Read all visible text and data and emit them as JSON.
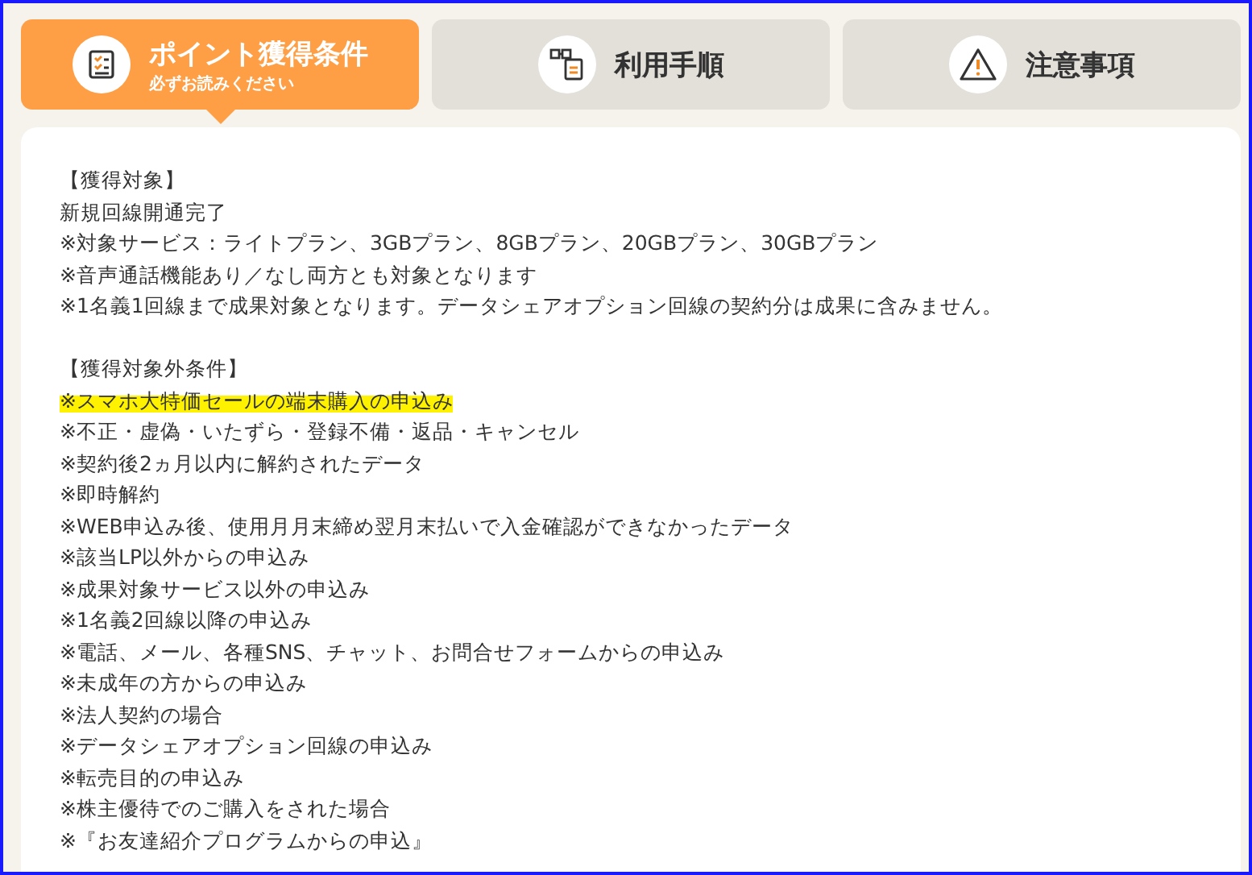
{
  "tabs": [
    {
      "label": "ポイント獲得条件",
      "sublabel": "必ずお読みください",
      "kind": "checklist",
      "selected": true
    },
    {
      "label": "利用手順",
      "kind": "steps",
      "selected": false
    },
    {
      "label": "注意事項",
      "kind": "warning",
      "selected": false
    }
  ],
  "sections": [
    {
      "heading": "【獲得対象】",
      "lines": [
        {
          "text": "新規回線開通完了",
          "highlighted": false
        },
        {
          "text": "※対象サービス：ライトプラン、3GBプラン、8GBプラン、20GBプラン、30GBプラン",
          "highlighted": false
        },
        {
          "text": "※音声通話機能あり／なし両方とも対象となります",
          "highlighted": false
        },
        {
          "text": "※1名義1回線まで成果対象となります。データシェアオプション回線の契約分は成果に含みません。",
          "highlighted": false
        }
      ]
    },
    {
      "heading": "【獲得対象外条件】",
      "lines": [
        {
          "text": "※スマホ大特価セールの端末購入の申込み",
          "highlighted": true
        },
        {
          "text": "※不正・虚偽・いたずら・登録不備・返品・キャンセル",
          "highlighted": false
        },
        {
          "text": "※契約後2ヵ月以内に解約されたデータ",
          "highlighted": false
        },
        {
          "text": "※即時解約",
          "highlighted": false
        },
        {
          "text": "※WEB申込み後、使用月月末締め翌月末払いで入金確認ができなかったデータ",
          "highlighted": false
        },
        {
          "text": "※該当LP以外からの申込み",
          "highlighted": false
        },
        {
          "text": "※成果対象サービス以外の申込み",
          "highlighted": false
        },
        {
          "text": "※1名義2回線以降の申込み",
          "highlighted": false
        },
        {
          "text": "※電話、メール、各種SNS、チャット、お問合せフォームからの申込み",
          "highlighted": false
        },
        {
          "text": "※未成年の方からの申込み",
          "highlighted": false
        },
        {
          "text": "※法人契約の場合",
          "highlighted": false
        },
        {
          "text": "※データシェアオプション回線の申込み",
          "highlighted": false
        },
        {
          "text": "※転売目的の申込み",
          "highlighted": false
        },
        {
          "text": "※株主優待でのご購入をされた場合",
          "highlighted": false
        },
        {
          "text": "※『お友達紹介プログラムからの申込』",
          "highlighted": false
        }
      ]
    }
  ]
}
